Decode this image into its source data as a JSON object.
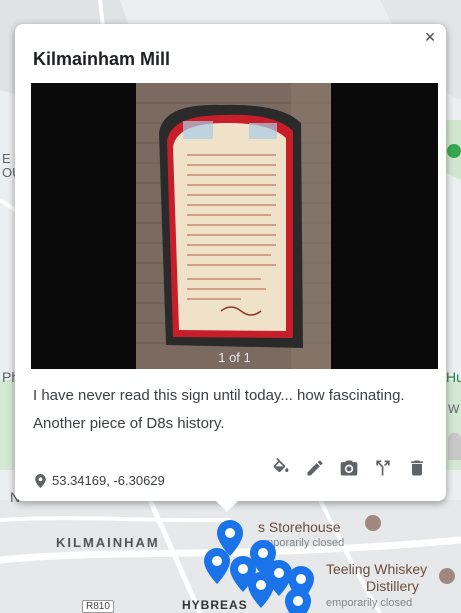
{
  "popup": {
    "title": "Kilmainham Mill",
    "close_label": "×",
    "photo_counter": "1 of 1",
    "description": "I have never read this sign until today... how fascinating. Another piece of D8s history.",
    "coordinates": "53.34169, -6.30629",
    "actions": [
      "fill-color-icon",
      "edit-icon",
      "camera-icon",
      "route-icon",
      "delete-icon"
    ]
  },
  "map": {
    "labels": {
      "kilmainham": "KILMAINHAM",
      "hybreasal": "HYBREAS",
      "storehouse": "s Storehouse",
      "storehouse_status": "emporarily closed",
      "teeling": "Teeling Whiskey",
      "distillery": "Distillery",
      "teeling_status": "emporarily closed",
      "road": "R810",
      "left_fragment": "Ph",
      "right_fragment": "Hu",
      "top_left_fragment": "E\nOU",
      "right_fragment_2": "W",
      "bottom_left_fragment": "N"
    },
    "pin_color": "#1a73e8"
  }
}
